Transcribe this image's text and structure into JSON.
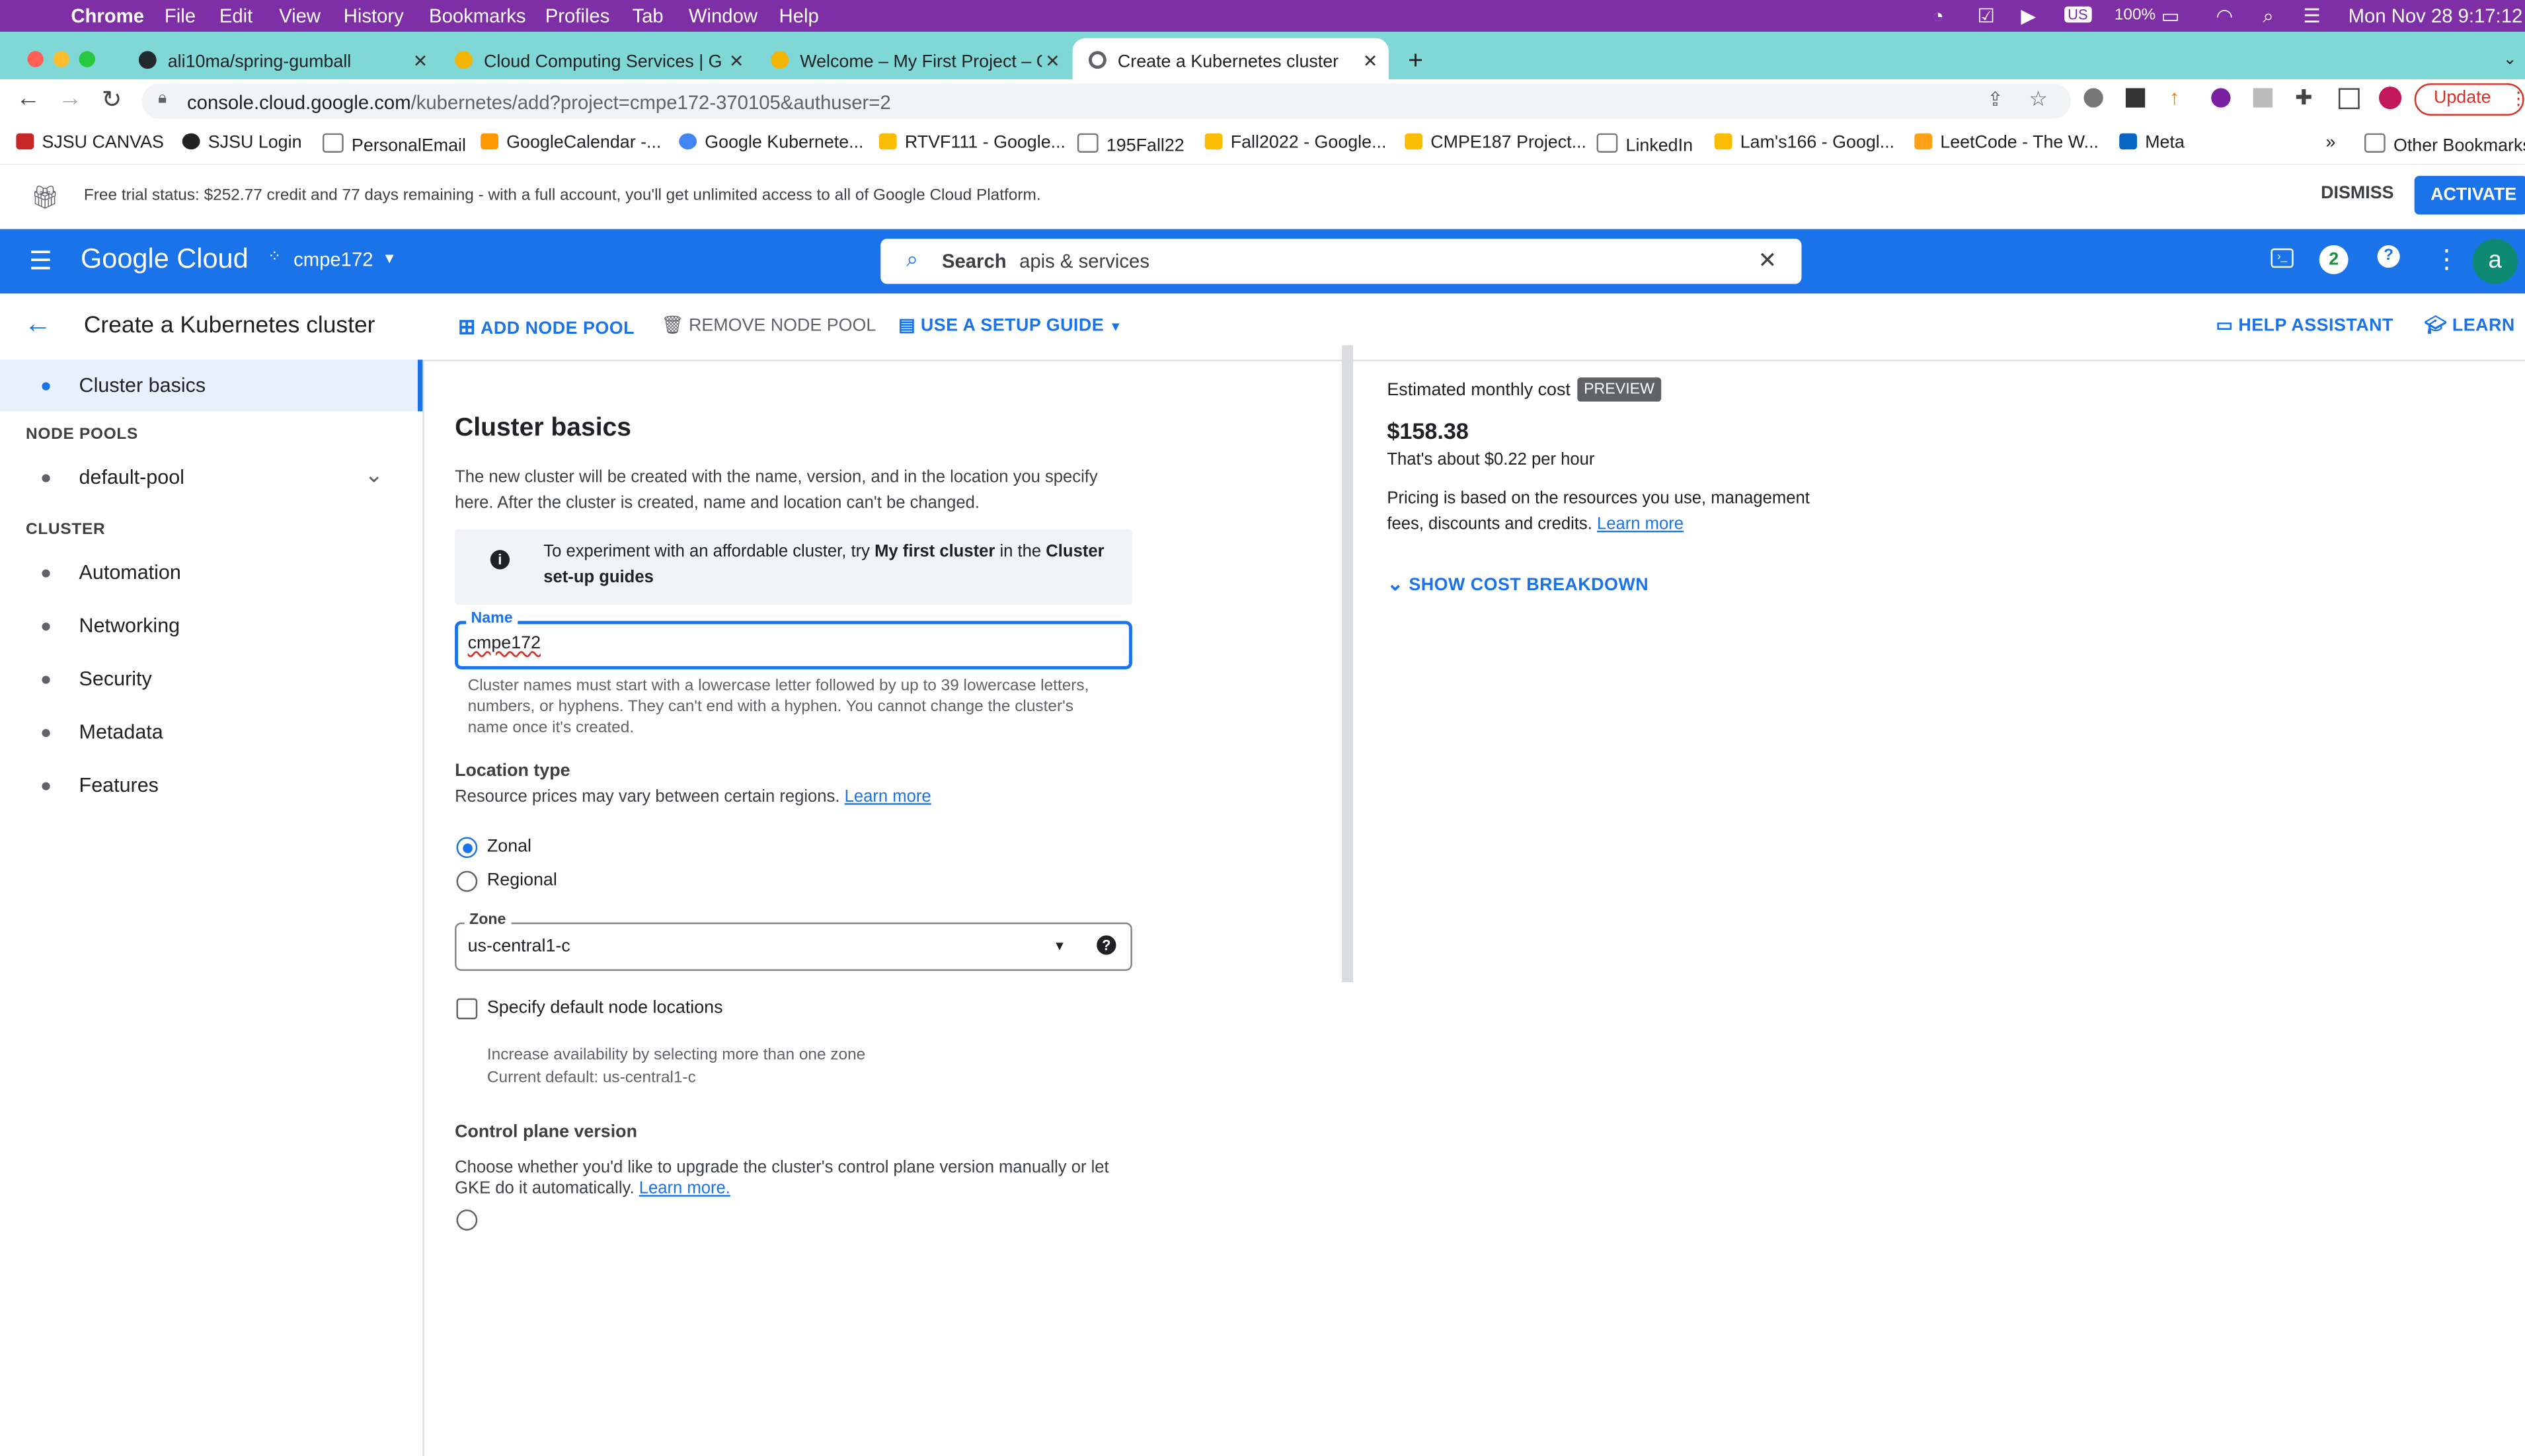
{
  "menubar": {
    "app": "Chrome",
    "items": [
      "File",
      "Edit",
      "View",
      "History",
      "Bookmarks",
      "Profiles",
      "Tab",
      "Window",
      "Help"
    ],
    "battery": "100%",
    "clock": "Mon Nov 28  9:17:12"
  },
  "tabs": [
    {
      "title": "ali10ma/spring-gumball",
      "color": "#24292f"
    },
    {
      "title": "Cloud Computing Services  |  G",
      "color": "#f4b400"
    },
    {
      "title": "Welcome – My First Project – G",
      "color": "#f4b400"
    },
    {
      "title": "Create a Kubernetes cluster – K",
      "color": "#5f6368"
    }
  ],
  "address": {
    "domain": "console.cloud.google.com",
    "path": "/kubernetes/add?project=cmpe172-370105&authuser=2",
    "update_label": "Update"
  },
  "bookmarks": [
    {
      "label": "SJSU CANVAS",
      "color": "#c62828"
    },
    {
      "label": "SJSU Login",
      "color": "#222"
    },
    {
      "label": "PersonalEmail",
      "color": "#777"
    },
    {
      "label": "GoogleCalendar -...",
      "color": "#ff9800"
    },
    {
      "label": "Google Kubernete...",
      "color": "#4285f4"
    },
    {
      "label": "RTVF111 - Google...",
      "color": "#fbbc04"
    },
    {
      "label": "195Fall22",
      "color": "#777"
    },
    {
      "label": "Fall2022 - Google...",
      "color": "#fbbc04"
    },
    {
      "label": "CMPE187 Project...",
      "color": "#fbbc04"
    },
    {
      "label": "LinkedIn",
      "color": "#777"
    },
    {
      "label": "Lam's166 - Googl...",
      "color": "#fbbc04"
    },
    {
      "label": "LeetCode - The W...",
      "color": "#ffa116"
    },
    {
      "label": "Meta",
      "color": "#0a66c2"
    }
  ],
  "bookmarks_more": "»",
  "other_bookmarks": "Other Bookmarks",
  "trial": {
    "text": "Free trial status: $252.77 credit and 77 days remaining - with a full account, you'll get unlimited access to all of Google Cloud Platform.",
    "dismiss": "DISMISS",
    "activate": "ACTIVATE"
  },
  "gc": {
    "logo": "Google Cloud",
    "project": "cmpe172",
    "search_label": "Search",
    "search_value": "apis & services",
    "notif_count": "2",
    "avatar": "a"
  },
  "subhead": {
    "title": "Create a Kubernetes cluster",
    "add_node_pool": "ADD NODE POOL",
    "remove_node_pool": "REMOVE NODE POOL",
    "setup_guide": "USE A SETUP GUIDE",
    "help_assistant": "HELP ASSISTANT",
    "learn": "LEARN"
  },
  "nav": {
    "cluster_basics": "Cluster basics",
    "node_pools_header": "NODE POOLS",
    "default_pool": "default-pool",
    "cluster_header": "CLUSTER",
    "items": [
      "Automation",
      "Networking",
      "Security",
      "Metadata",
      "Features"
    ]
  },
  "main": {
    "heading": "Cluster basics",
    "intro": "The new cluster will be created with the name, version, and in the location you specify here. After the cluster is created, name and location can't be changed.",
    "info_pre": "To experiment with an affordable cluster, try ",
    "info_bold1": "My first cluster",
    "info_mid": " in the ",
    "info_bold2": "Cluster set-up guides",
    "name_label": "Name",
    "name_value": "cmpe172",
    "name_help": "Cluster names must start with a lowercase letter followed by up to 39 lowercase letters, numbers, or hyphens. They can't end with a hyphen. You cannot change the cluster's name once it's created.",
    "location_type": "Location type",
    "location_help": "Resource prices may vary between certain regions.",
    "learn_more": "Learn more",
    "zonal": "Zonal",
    "regional": "Regional",
    "zone_label": "Zone",
    "zone_value": "us-central1-c",
    "specify_nodes": "Specify default node locations",
    "nodes_help1": "Increase availability by selecting more than one zone",
    "nodes_help2": "Current default: us-central1-c",
    "cp_version": "Control plane version",
    "cp_help": "Choose whether you'd like to upgrade the cluster's control plane version manually or let GKE do it automatically.",
    "cp_learn": "Learn more."
  },
  "cost": {
    "label": "Estimated monthly cost",
    "badge": "PREVIEW",
    "amount": "$158.38",
    "hourly": "That's about $0.22 per hour",
    "pricing": "Pricing is based on the resources you use, management fees, discounts and credits.",
    "learn_more": "Learn more",
    "breakdown": "SHOW COST BREAKDOWN"
  }
}
